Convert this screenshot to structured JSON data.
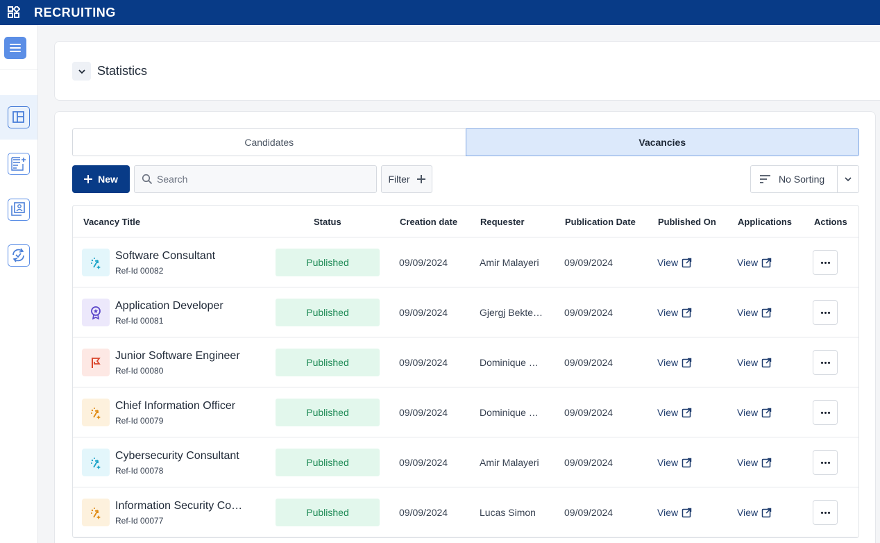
{
  "app": {
    "title": "RECRUITING",
    "icon": "apps-grid-icon"
  },
  "sidebar": {
    "items": [
      {
        "name": "dashboard-layout-icon",
        "active": true
      },
      {
        "name": "new-document-icon",
        "active": false
      },
      {
        "name": "library-icon",
        "active": false
      },
      {
        "name": "sync-check-icon",
        "active": false
      }
    ]
  },
  "statistics": {
    "title": "Statistics"
  },
  "tabs": [
    {
      "label": "Candidates",
      "active": false
    },
    {
      "label": "Vacancies",
      "active": true
    }
  ],
  "toolbar": {
    "new_label": "New",
    "search_placeholder": "Search",
    "filter_label": "Filter",
    "sort_label": "No Sorting"
  },
  "table": {
    "headers": {
      "title": "Vacancy Title",
      "status": "Status",
      "creation_date": "Creation date",
      "requester": "Requester",
      "publication_date": "Publication Date",
      "published_on": "Published On",
      "applications": "Applications",
      "actions": "Actions"
    },
    "rows": [
      {
        "title": "Software Consultant",
        "ref": "Ref-Id 00082",
        "status": "Published",
        "created": "09/09/2024",
        "requester": "Amir Malayeri",
        "published": "09/09/2024",
        "published_on": "View",
        "applications": "View",
        "icon": "sparkle-arrow-icon",
        "tile_color": "#e3f6fb",
        "icon_color": "#1aa3c8"
      },
      {
        "title": "Application Developer",
        "ref": "Ref-Id 00081",
        "status": "Published",
        "created": "09/09/2024",
        "requester": "Gjergj Bekte…",
        "published": "09/09/2024",
        "published_on": "View",
        "applications": "View",
        "icon": "award-badge-icon",
        "tile_color": "#ece8fb",
        "icon_color": "#5b46c9"
      },
      {
        "title": "Junior Software Engineer",
        "ref": "Ref-Id 00080",
        "status": "Published",
        "created": "09/09/2024",
        "requester": "Dominique …",
        "published": "09/09/2024",
        "published_on": "View",
        "applications": "View",
        "icon": "flag-icon",
        "tile_color": "#fde8e4",
        "icon_color": "#d9452b"
      },
      {
        "title": "Chief Information Officer",
        "ref": "Ref-Id 00079",
        "status": "Published",
        "created": "09/09/2024",
        "requester": "Dominique …",
        "published": "09/09/2024",
        "published_on": "View",
        "applications": "View",
        "icon": "sparkle-arrow-icon",
        "tile_color": "#fdf1dd",
        "icon_color": "#e08a12"
      },
      {
        "title": "Cybersecurity Consultant",
        "ref": "Ref-Id 00078",
        "status": "Published",
        "created": "09/09/2024",
        "requester": "Amir Malayeri",
        "published": "09/09/2024",
        "published_on": "View",
        "applications": "View",
        "icon": "sparkle-arrow-icon",
        "tile_color": "#e3f6fb",
        "icon_color": "#1aa3c8"
      },
      {
        "title": "Information Security Co…",
        "ref": "Ref-Id 00077",
        "status": "Published",
        "created": "09/09/2024",
        "requester": "Lucas Simon",
        "published": "09/09/2024",
        "published_on": "View",
        "applications": "View",
        "icon": "sparkle-arrow-icon",
        "tile_color": "#fdf1dd",
        "icon_color": "#e08a12"
      }
    ]
  }
}
